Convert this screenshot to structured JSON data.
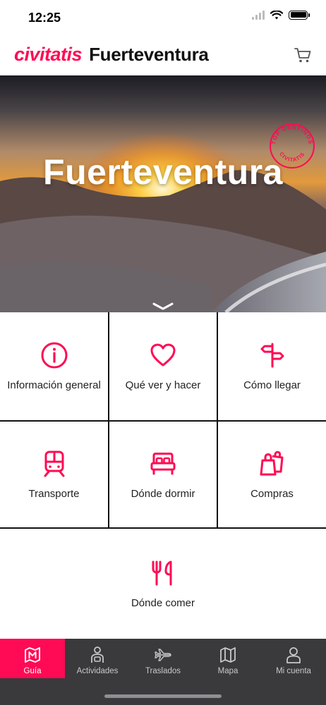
{
  "status": {
    "time": "12:25"
  },
  "header": {
    "logo": "civitatis",
    "city": "Fuerteventura",
    "cart_icon": "cart-icon"
  },
  "hero": {
    "title": "Fuerteventura",
    "badge_top": "· TOP DESTINOS ·",
    "badge_bottom": "CIVITATIS"
  },
  "menu": [
    {
      "label": "Información general",
      "icon": "info-icon"
    },
    {
      "label": "Qué ver y hacer",
      "icon": "heart-icon"
    },
    {
      "label": "Cómo llegar",
      "icon": "signpost-icon"
    },
    {
      "label": "Transporte",
      "icon": "train-icon"
    },
    {
      "label": "Dónde dormir",
      "icon": "bed-icon"
    },
    {
      "label": "Compras",
      "icon": "shopping-bags-icon"
    },
    {
      "label": "Dónde comer",
      "icon": "cutlery-icon"
    }
  ],
  "tabs": [
    {
      "label": "Guía",
      "icon": "map-guide-icon",
      "active": true
    },
    {
      "label": "Actividades",
      "icon": "activities-icon",
      "active": false
    },
    {
      "label": "Traslados",
      "icon": "plane-icon",
      "active": false
    },
    {
      "label": "Mapa",
      "icon": "map-icon",
      "active": false
    },
    {
      "label": "Mi cuenta",
      "icon": "user-icon",
      "active": false
    }
  ],
  "colors": {
    "brand": "#ff0a54",
    "tabbar": "#3a3a3c"
  }
}
